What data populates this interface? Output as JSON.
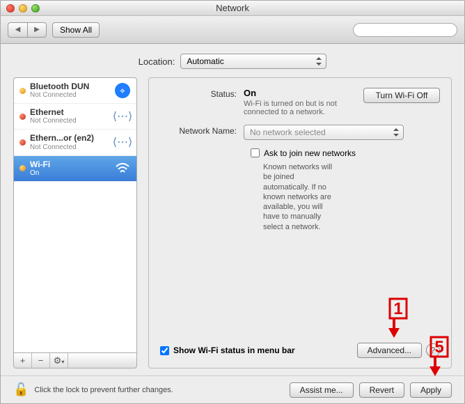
{
  "window": {
    "title": "Network"
  },
  "toolbar": {
    "show_all": "Show All",
    "search_placeholder": ""
  },
  "location": {
    "label": "Location:",
    "value": "Automatic"
  },
  "services": [
    {
      "name": "Bluetooth DUN",
      "status": "Not Connected",
      "dot": "amber",
      "icon": "bluetooth"
    },
    {
      "name": "Ethernet",
      "status": "Not Connected",
      "dot": "red",
      "icon": "ethernet"
    },
    {
      "name": "Ethern...or (en2)",
      "status": "Not Connected",
      "dot": "red",
      "icon": "ethernet"
    },
    {
      "name": "Wi-Fi",
      "status": "On",
      "dot": "amber",
      "icon": "wifi",
      "selected": true
    }
  ],
  "sidebar_actions": {
    "add": "+",
    "remove": "−",
    "gear": "⚙"
  },
  "detail": {
    "status_label": "Status:",
    "status_value": "On",
    "status_desc": "Wi-Fi is turned on but is not connected to a network.",
    "wifi_toggle": "Turn Wi-Fi Off",
    "network_name_label": "Network Name:",
    "network_name_value": "No network selected",
    "ask_join_label": "Ask to join new networks",
    "ask_join_desc": "Known networks will be joined automatically. If no known networks are available, you will have to manually select a network.",
    "show_status_label": "Show Wi-Fi status in menu bar",
    "advanced": "Advanced...",
    "help": "?"
  },
  "footer": {
    "lock_text": "Click the lock to prevent further changes.",
    "assist": "Assist me...",
    "revert": "Revert",
    "apply": "Apply"
  },
  "annotations": {
    "one": "1",
    "five": "5"
  }
}
